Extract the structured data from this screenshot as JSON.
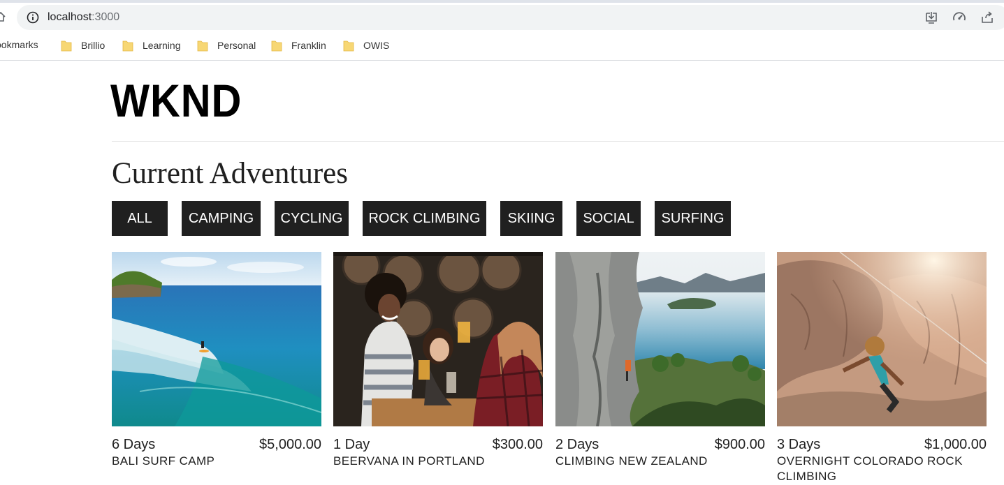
{
  "browser": {
    "url_host": "localhost",
    "url_port": ":3000",
    "bookmarks_label": "ookmarks",
    "bookmarks": [
      "Brillio",
      "Learning",
      "Personal",
      "Franklin",
      "OWIS"
    ]
  },
  "site": {
    "logo": "WKND",
    "title": "Current Adventures"
  },
  "filters": [
    "ALL",
    "CAMPING",
    "CYCLING",
    "ROCK CLIMBING",
    "SKIING",
    "SOCIAL",
    "SURFING"
  ],
  "adventures": [
    {
      "duration": "6 Days",
      "price": "$5,000.00",
      "name": "BALI SURF CAMP",
      "photo": "surfing-photo"
    },
    {
      "duration": "1 Day",
      "price": "$300.00",
      "name": "BEERVANA IN PORTLAND",
      "photo": "friends-at-bar-photo"
    },
    {
      "duration": "2 Days",
      "price": "$900.00",
      "name": "CLIMBING NEW ZEALAND",
      "photo": "cliff-lake-photo"
    },
    {
      "duration": "3 Days",
      "price": "$1,000.00",
      "name": "OVERNIGHT COLORADO ROCK CLIMBING",
      "photo": "rock-climber-photo"
    }
  ]
}
